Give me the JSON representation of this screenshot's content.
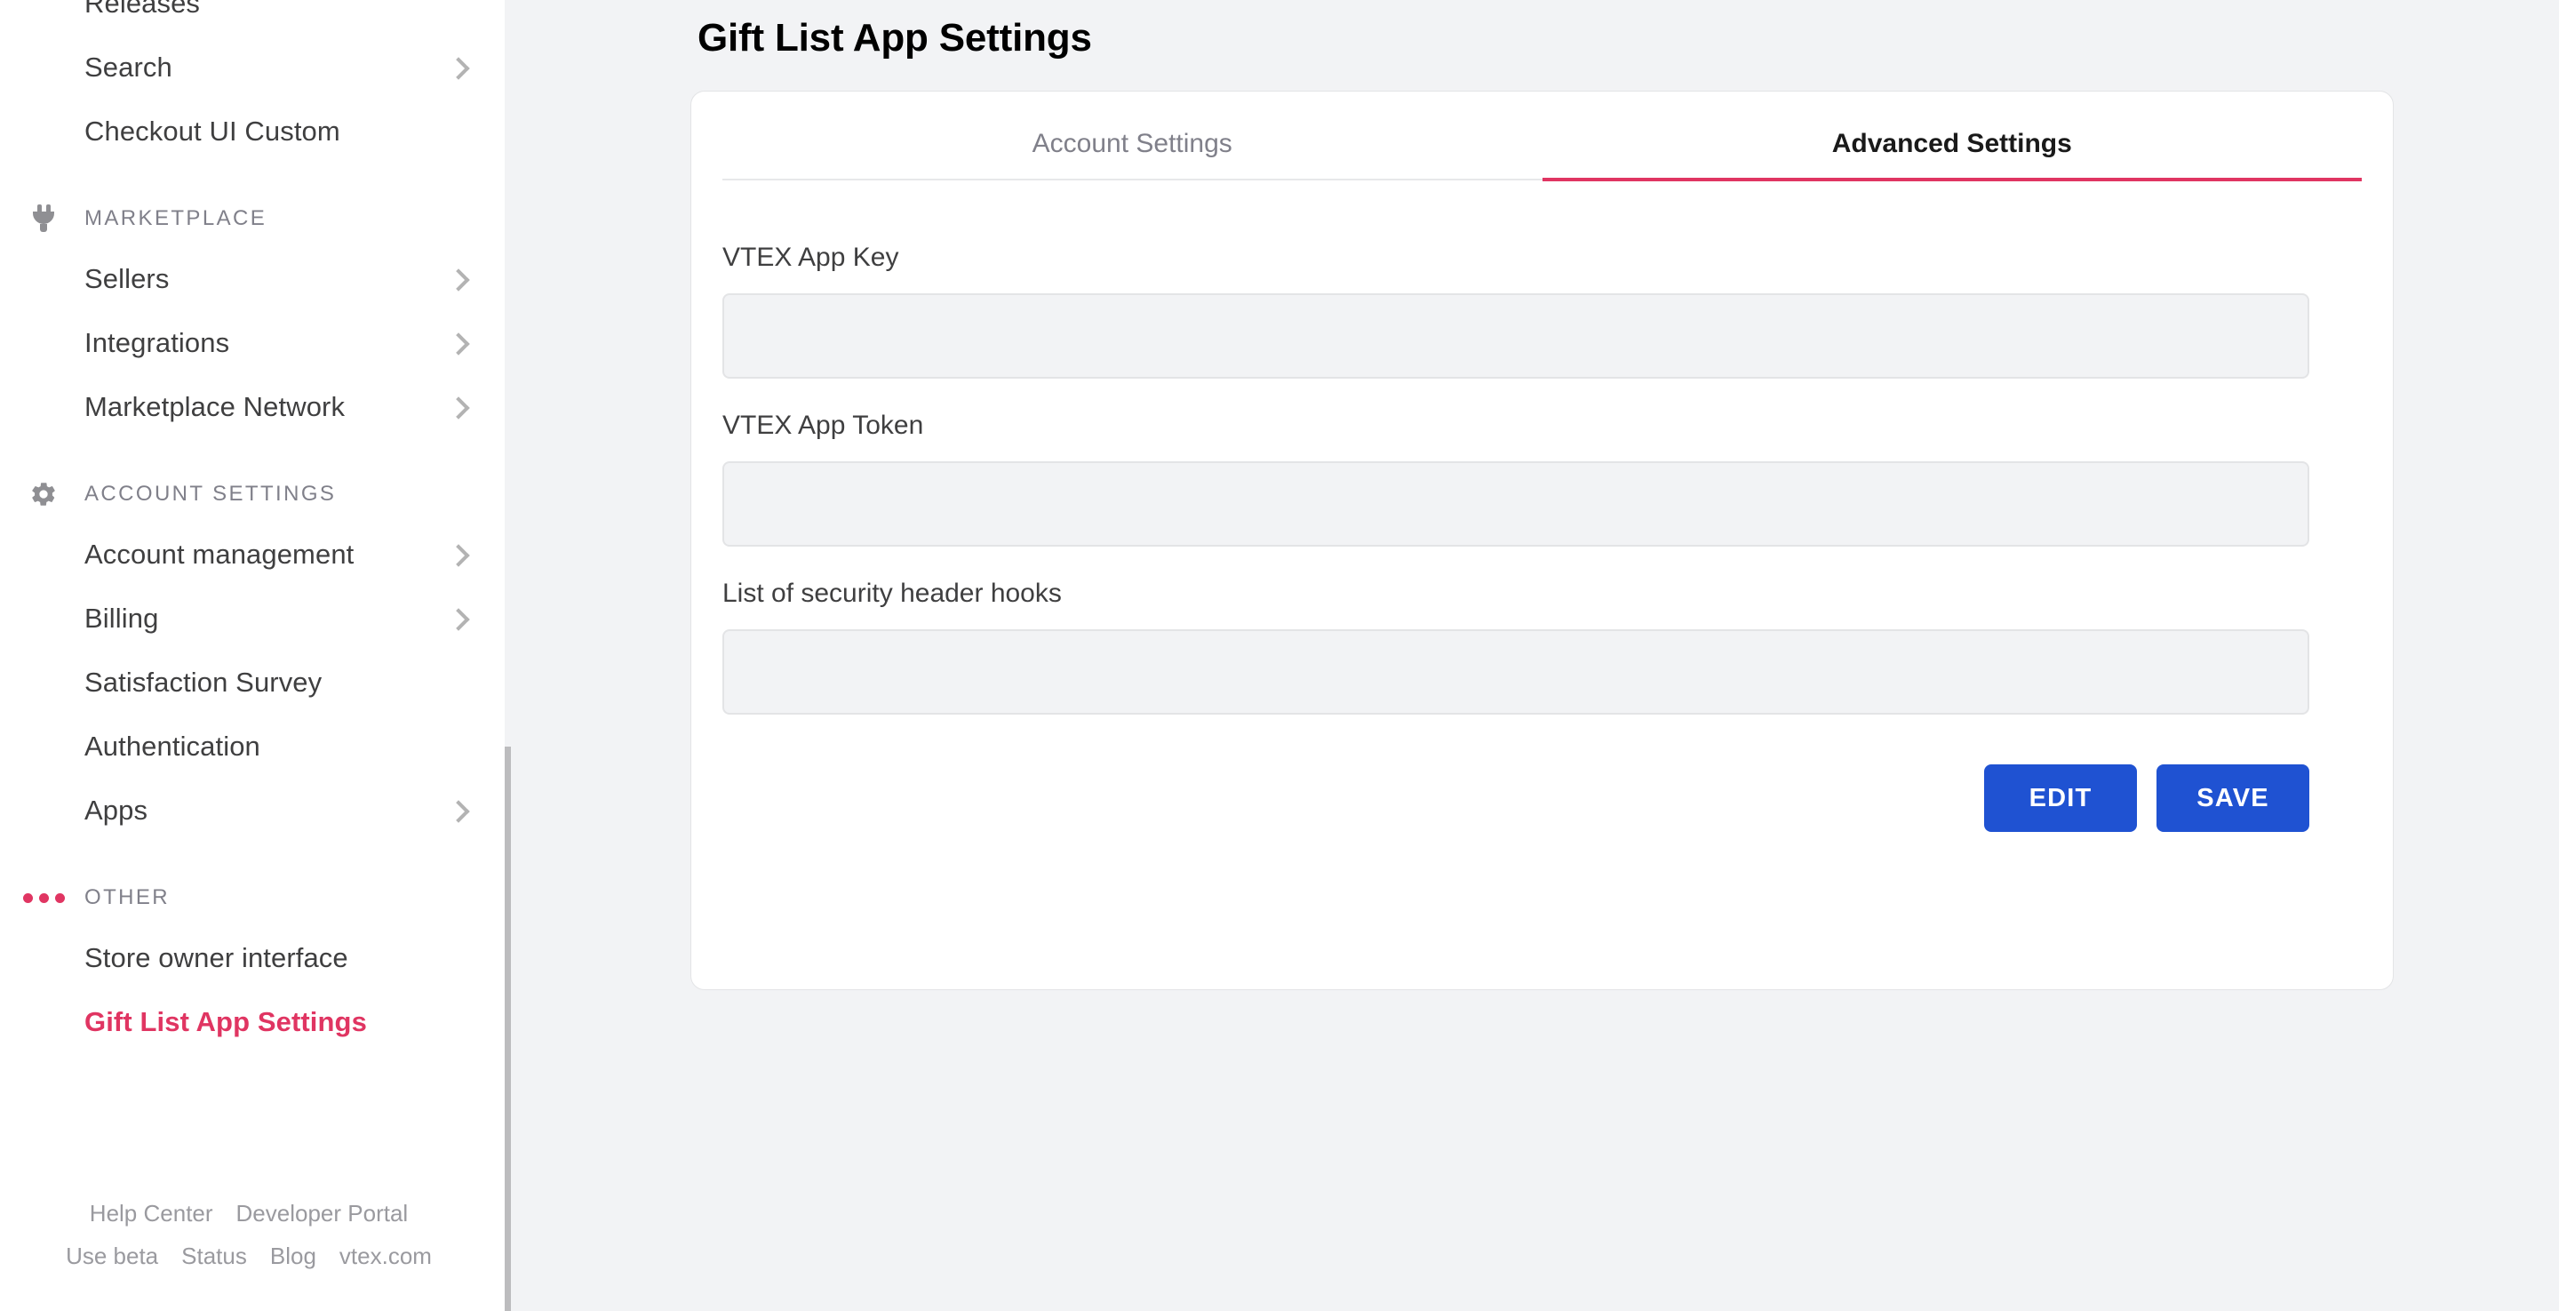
{
  "colors": {
    "brand_pink": "#e03562",
    "primary_blue": "#1f52d2",
    "page_background": "#f2f3f5",
    "card_background": "#ffffff",
    "text_default": "#3f3f40",
    "text_muted": "#80808a"
  },
  "sidebar": {
    "top_items": [
      {
        "label": "Releases",
        "icon": "",
        "has_chevron": false,
        "active": false
      },
      {
        "label": "Search",
        "icon": "chevron-right-icon",
        "has_chevron": true,
        "active": false
      },
      {
        "label": "Checkout UI Custom",
        "icon": "",
        "has_chevron": false,
        "active": false
      }
    ],
    "sections": [
      {
        "label": "MARKETPLACE",
        "icon": "plug-icon",
        "items": [
          {
            "label": "Sellers",
            "has_chevron": true,
            "active": false
          },
          {
            "label": "Integrations",
            "has_chevron": true,
            "active": false
          },
          {
            "label": "Marketplace Network",
            "has_chevron": true,
            "active": false
          }
        ]
      },
      {
        "label": "ACCOUNT SETTINGS",
        "icon": "gear-icon",
        "items": [
          {
            "label": "Account management",
            "has_chevron": true,
            "active": false
          },
          {
            "label": "Billing",
            "has_chevron": true,
            "active": false
          },
          {
            "label": "Satisfaction Survey",
            "has_chevron": false,
            "active": false
          },
          {
            "label": "Authentication",
            "has_chevron": false,
            "active": false
          },
          {
            "label": "Apps",
            "has_chevron": true,
            "active": false
          }
        ]
      },
      {
        "label": "OTHER",
        "icon": "three-dots-icon",
        "items": [
          {
            "label": "Store owner interface",
            "has_chevron": false,
            "active": false
          },
          {
            "label": "Gift List App Settings",
            "has_chevron": false,
            "active": true
          }
        ]
      }
    ],
    "footer": {
      "row1": [
        {
          "label": "Help Center"
        },
        {
          "label": "Developer Portal"
        }
      ],
      "row2": [
        {
          "label": "Use beta"
        },
        {
          "label": "Status"
        },
        {
          "label": "Blog"
        },
        {
          "label": "vtex.com"
        }
      ]
    }
  },
  "main": {
    "page_title": "Gift List App Settings",
    "tabs": [
      {
        "label": "Account Settings",
        "active": false
      },
      {
        "label": "Advanced Settings",
        "active": true
      }
    ],
    "fields": [
      {
        "label": "VTEX App Key",
        "value": "",
        "placeholder": ""
      },
      {
        "label": "VTEX App Token",
        "value": "",
        "placeholder": ""
      },
      {
        "label": "List of security header hooks",
        "value": "",
        "placeholder": ""
      }
    ],
    "buttons": [
      {
        "label": "EDIT",
        "name": "edit-button"
      },
      {
        "label": "SAVE",
        "name": "save-button"
      }
    ]
  }
}
